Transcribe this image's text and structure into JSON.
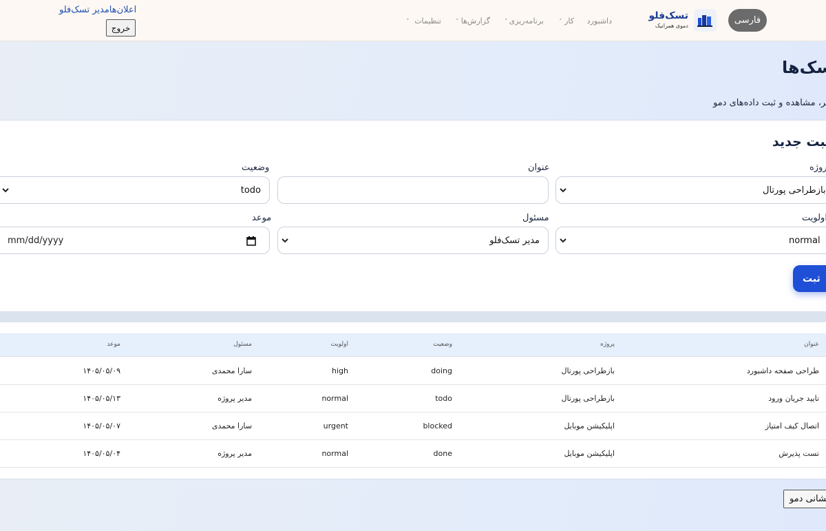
{
  "header": {
    "language_button": "فارسی",
    "brand_title": "تسک‌فلو",
    "brand_subtitle": "دموی همرانیک",
    "nav": [
      {
        "label": "داشبورد"
      },
      {
        "label": "کار"
      },
      {
        "label": "برنامه‌ریزی"
      },
      {
        "label": "گزارش‌ها"
      },
      {
        "label": "تنظیمات"
      }
    ],
    "notifications_link": "اعلان‌ها",
    "user_name": "مدیر تسک‌فلو",
    "logout_button": "خروج"
  },
  "hero": {
    "title": "تسک‌ها",
    "subtitle": "فیلتر، مشاهده و ثبت داده‌های دمو"
  },
  "form": {
    "title": "ثبت جدید",
    "project_label": "پروژه",
    "project_value": "بازطراحی پورتال",
    "title_label": "عنوان",
    "title_value": "",
    "status_label": "وضعیت",
    "status_value": "todo",
    "priority_label": "اولویت",
    "priority_value": "normal",
    "assignee_label": "مسئول",
    "assignee_value": "مدیر تسک‌فلو",
    "due_label": "موعد",
    "due_placeholder": "mm/dd/yyyy",
    "submit_button": "ثبت"
  },
  "table": {
    "columns": [
      "عنوان",
      "پروژه",
      "وضعیت",
      "اولویت",
      "مسئول",
      "موعد"
    ],
    "rows": [
      [
        "طراحی صفحه داشبورد",
        "بازطراحی پورتال",
        "doing",
        "high",
        "سارا محمدی",
        "۱۴۰۵/۰۵/۰۹"
      ],
      [
        "تایید جریان ورود",
        "بازطراحی پورتال",
        "todo",
        "normal",
        "مدیر پروژه",
        "۱۴۰۵/۰۵/۱۳"
      ],
      [
        "اتصال کیف امتیاز",
        "اپلیکیشن موبایل",
        "blocked",
        "urgent",
        "سارا محمدی",
        "۱۴۰۵/۰۵/۰۷"
      ],
      [
        "تست پذیرش",
        "اپلیکیشن موبایل",
        "done",
        "normal",
        "مدیر پروژه",
        "۱۴۰۵/۰۵/۰۴"
      ]
    ]
  },
  "footer": {
    "reset_button": "بازنشانی دمو"
  },
  "colors": {
    "accent": "#1f4fd6",
    "brand": "#1d3f91",
    "header_bg": "#fdf8f3",
    "hero_bg": "#e3ecfa"
  }
}
